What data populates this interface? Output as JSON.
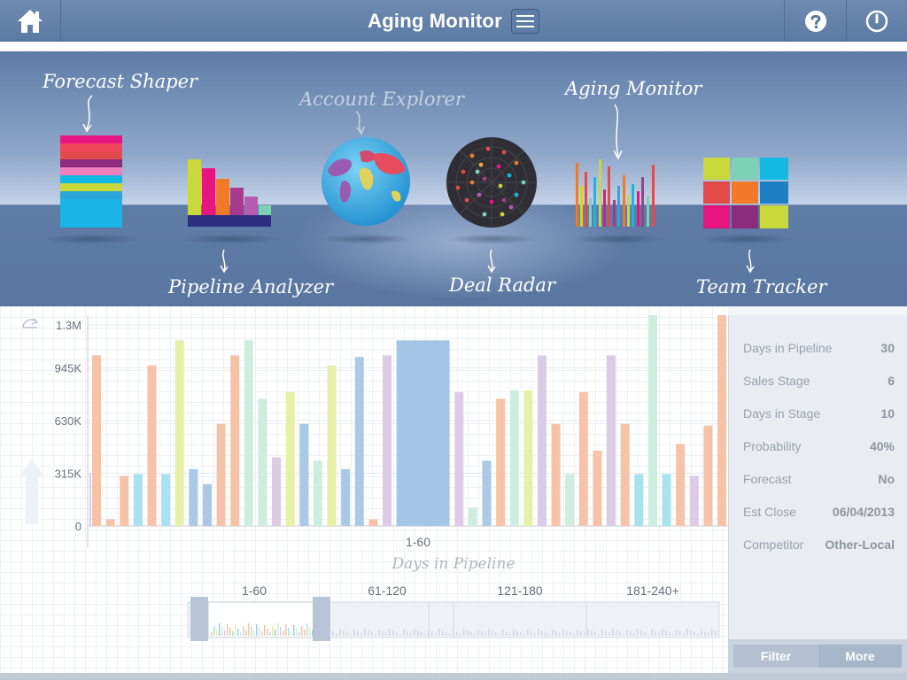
{
  "header": {
    "title": "Aging Monitor"
  },
  "apps": [
    {
      "name": "forecast-shaper",
      "label": "Forecast Shaper"
    },
    {
      "name": "pipeline-analyzer",
      "label": "Pipeline Analyzer"
    },
    {
      "name": "account-explorer",
      "label": "Account Explorer"
    },
    {
      "name": "deal-radar",
      "label": "Deal Radar"
    },
    {
      "name": "aging-monitor",
      "label": "Aging Monitor"
    },
    {
      "name": "team-tracker",
      "label": "Team Tracker"
    }
  ],
  "chart_data": {
    "type": "bar",
    "xlabel": "Days in Pipeline",
    "category_label": "1-60",
    "y_ticks": [
      "0",
      "315K",
      "630K",
      "945K",
      "1.3M"
    ],
    "ylim": [
      0,
      1260000
    ],
    "values": [
      1020000,
      40000,
      300000,
      310000,
      960000,
      310000,
      1110000,
      340000,
      250000,
      610000,
      1020000,
      1110000,
      760000,
      410000,
      800000,
      610000,
      390000,
      960000,
      340000,
      1010000,
      40000,
      1020000,
      1110000,
      800000,
      110000,
      390000,
      760000,
      810000,
      810000,
      1020000,
      610000,
      310000,
      800000,
      450000,
      1020000,
      610000,
      310000,
      1260000,
      310000,
      490000,
      300000,
      600000,
      1260000
    ],
    "highlight_index": 22,
    "colors": [
      "#f6c3a8",
      "#f6c3a8",
      "#f6c3a8",
      "#a7e2ee",
      "#f6c3a8",
      "#a7e2ee",
      "#e6f0a6",
      "#a9c9e6",
      "#a9c9e6",
      "#f6c3a8",
      "#f6c3a8",
      "#cdeede",
      "#cdeede",
      "#dccbe6",
      "#e6f0a6",
      "#a9c9e6",
      "#cdeede",
      "#e6f0a6",
      "#a9c9e6",
      "#a9c9e6",
      "#f6c3a8",
      "#dccbe6",
      "#a3c6e6",
      "#dccbe6",
      "#cdeede",
      "#a9c9e6",
      "#f6c3a8",
      "#cdeede",
      "#e6f0a6",
      "#dccbe6",
      "#f6c3a8",
      "#cdeede",
      "#f6c3a8",
      "#f6c3a8",
      "#dccbe6",
      "#f6c3a8",
      "#a7e2ee",
      "#cdeede",
      "#a7e2ee",
      "#f6c3a8",
      "#dccbe6",
      "#f6c3a8",
      "#f6c3a8"
    ],
    "scrubber": {
      "labels": [
        "1-60",
        "61-120",
        "121-180",
        "181-240+"
      ]
    }
  },
  "details": [
    {
      "key": "Days in Pipeline",
      "value": "30"
    },
    {
      "key": "Sales Stage",
      "value": "6"
    },
    {
      "key": "Days in Stage",
      "value": "10"
    },
    {
      "key": "Probability",
      "value": "40%"
    },
    {
      "key": "Forecast",
      "value": "No"
    },
    {
      "key": "Est Close",
      "value": "06/04/2013"
    },
    {
      "key": "Competitor",
      "value": "Other-Local"
    }
  ],
  "buttons": {
    "filter": "Filter",
    "more": "More"
  }
}
